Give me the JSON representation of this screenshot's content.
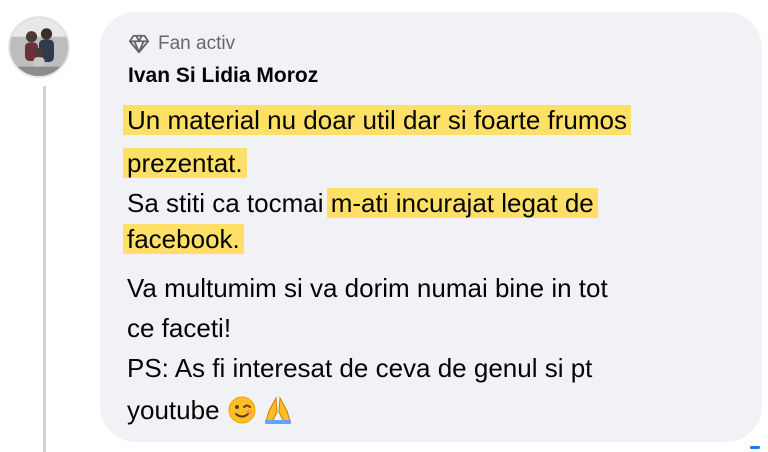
{
  "comment": {
    "badge_label": "Fan activ",
    "badge_icon": "diamond-icon",
    "author": "Ivan Si Lidia Moroz",
    "lines": [
      {
        "pre": "",
        "hl": "Un material nu doar util dar si foarte frumos",
        "post": ""
      },
      {
        "pre": "",
        "hl": "prezentat.",
        "post": ""
      },
      {
        "pre": "Sa stiti ca tocmai ",
        "hl": "m-ati incurajat legat de",
        "post": ""
      },
      {
        "pre": "",
        "hl": "facebook.",
        "post": ""
      },
      {
        "pre": "Va multumim si va dorim numai bine in tot",
        "hl": "",
        "post": ""
      },
      {
        "pre": "ce faceti!",
        "hl": "",
        "post": ""
      },
      {
        "pre": "PS: As fi interesat de ceva de genul si pt",
        "hl": "",
        "post": ""
      },
      {
        "pre": "youtube ",
        "hl": "",
        "post": ""
      }
    ],
    "emojis": [
      "winking-face-icon",
      "folded-hands-icon"
    ]
  },
  "colors": {
    "bubble": "#f0f2f5",
    "highlight": "#ffe066",
    "badge_text": "#65676b",
    "thread_line": "#d0d3d8"
  }
}
